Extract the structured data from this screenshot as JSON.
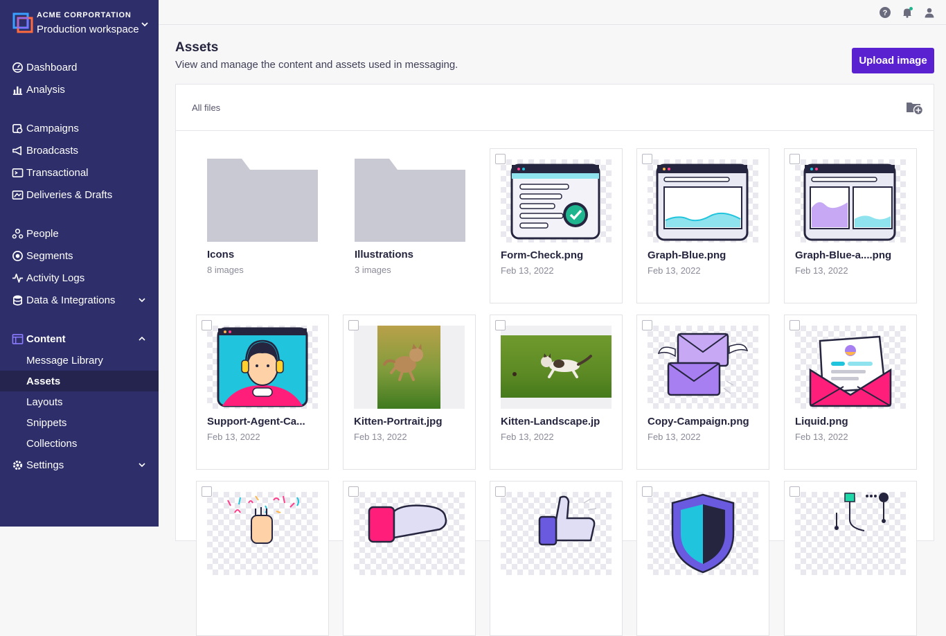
{
  "workspace": {
    "org": "ACME CORPORTATION",
    "name": "Production workspace"
  },
  "nav": {
    "dashboard": "Dashboard",
    "analysis": "Analysis",
    "campaigns": "Campaigns",
    "broadcasts": "Broadcasts",
    "transactional": "Transactional",
    "deliveries": "Deliveries & Drafts",
    "people": "People",
    "segments": "Segments",
    "activity_logs": "Activity Logs",
    "data_integrations": "Data & Integrations",
    "content": "Content",
    "content_items": [
      "Message Library",
      "Assets",
      "Layouts",
      "Snippets",
      "Collections"
    ],
    "settings": "Settings"
  },
  "page": {
    "title": "Assets",
    "subtitle": "View and manage the content and assets used in messaging.",
    "upload_label": "Upload image",
    "breadcrumb": "All files"
  },
  "folders": [
    {
      "name": "Icons",
      "count": "8 images"
    },
    {
      "name": "Illustrations",
      "count": "3 images"
    }
  ],
  "files": [
    {
      "name": "Form-Check.png",
      "date": "Feb 13, 2022"
    },
    {
      "name": "Graph-Blue.png",
      "date": "Feb 13, 2022"
    },
    {
      "name": "Graph-Blue-a....png",
      "date": "Feb 13, 2022"
    },
    {
      "name": "Support-Agent-Ca...",
      "date": "Feb 13, 2022"
    },
    {
      "name": "Kitten-Portrait.jpg",
      "date": "Feb 13, 2022"
    },
    {
      "name": "Kitten-Landscape.jp",
      "date": "Feb 13, 2022"
    },
    {
      "name": "Copy-Campaign.png",
      "date": "Feb 13, 2022"
    },
    {
      "name": "Liquid.png",
      "date": "Feb 13, 2022"
    }
  ],
  "colors": {
    "sidebar": "#2e2e6b",
    "accent": "#5a21d0",
    "notification_dot": "#1fb58f"
  }
}
